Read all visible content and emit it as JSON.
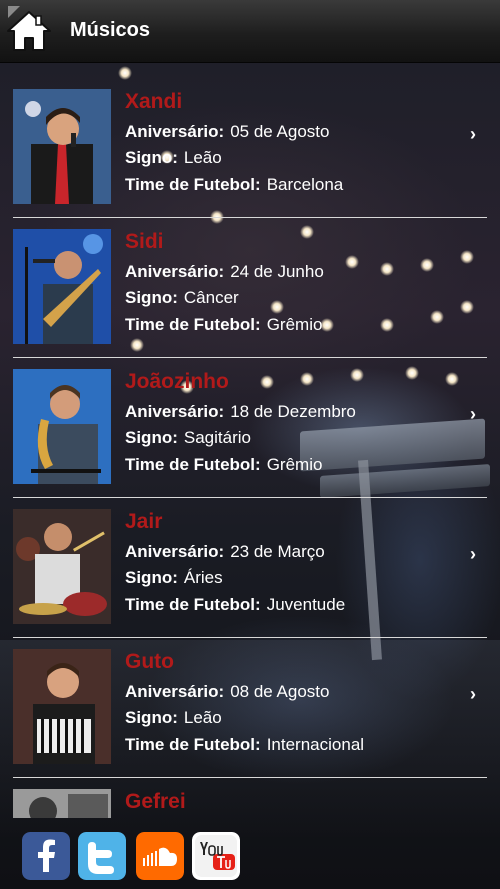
{
  "header": {
    "title": "Músicos"
  },
  "labels": {
    "birthday": "Aniversário:",
    "sign": "Signo:",
    "team": "Time de Futebol:"
  },
  "musicians": [
    {
      "name": "Xandi",
      "birthday": "05 de Agosto",
      "sign": "Leão",
      "team": "Barcelona"
    },
    {
      "name": "Sidi",
      "birthday": "24 de Junho",
      "sign": "Câncer",
      "team": "Grêmio"
    },
    {
      "name": "Joãozinho",
      "birthday": "18 de Dezembro",
      "sign": "Sagitário",
      "team": "Grêmio"
    },
    {
      "name": "Jair",
      "birthday": "23 de Março",
      "sign": "Áries",
      "team": "Juventude"
    },
    {
      "name": "Guto",
      "birthday": "08 de Agosto",
      "sign": "Leão",
      "team": "Internacional"
    },
    {
      "name": "Gefrei"
    }
  ],
  "social": [
    {
      "icon": "facebook-icon",
      "color": "#3b5998"
    },
    {
      "icon": "twitter-icon",
      "color": "#4fb3e8"
    },
    {
      "icon": "soundcloud-icon",
      "color": "#ff6a00"
    },
    {
      "icon": "youtube-icon",
      "color": "#e62117"
    }
  ],
  "colors": {
    "name_red": "#b11a1a",
    "header_dark": "#1e1e1e"
  }
}
